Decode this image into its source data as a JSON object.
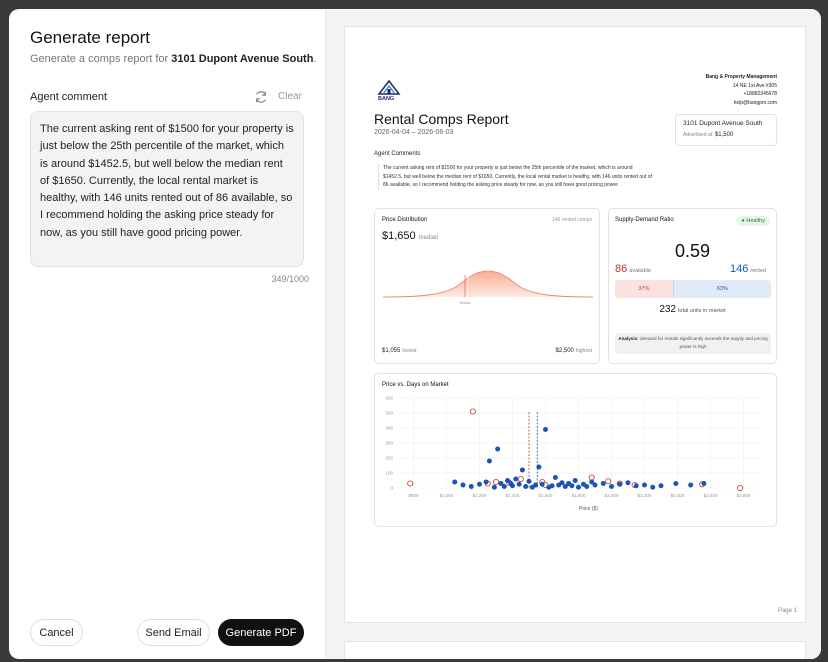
{
  "left": {
    "title": "Generate report",
    "subtitle_prefix": "Generate a comps report for ",
    "subtitle_address": "3101 Dupont Avenue South",
    "subtitle_suffix": ".",
    "comment_label": "Agent comment",
    "clear_label": "Clear",
    "comment_text": "The current asking rent of $1500 for your property is just below the 25th percentile of the market, which is around $1452.5, but well below the median rent of $1650. Currently, the local rental market is healthy, with 146 units rented out of 86 available, so I recommend holding the asking price steady for now, as you still have good pricing power.",
    "counter": "349/1000",
    "cancel_label": "Cancel",
    "send_email_label": "Send Email",
    "generate_pdf_label": "Generate PDF"
  },
  "report": {
    "logo_text": "BANG",
    "company_name": "Bang & Property Management",
    "company_address": "14 NE 1st Ave #305",
    "company_phone": "+18882345678",
    "company_email": "help@bangpm.com",
    "title": "Rental Comps Report",
    "dates": "2026-04-04 – 2026-06-03",
    "address": "3101 Dupont Avenue South",
    "advertised_label": "Advertised at:",
    "advertised_price": "$1,500",
    "agent_comments_label": "Agent Comments",
    "agent_comments_text": "The current asking rent of $1500 for your property is just below the 25th percentile of the market, which is around $1452.5, but well below the median rent of $1650. Currently, the local rental market is healthy, with 146 units rented out of 86 available, so I recommend holding the asking price steady for now, as you still have good pricing power.",
    "price_distribution": {
      "title": "Price Distribution",
      "rented_comps": "146 rented comps",
      "median_value": "$1,650",
      "median_label": "median",
      "lowest_value": "$1,055",
      "lowest_label": "lowest",
      "highest_value": "$2,500",
      "highest_label": "highest",
      "marker_label": "Median"
    },
    "supply_demand": {
      "title": "Supply-Demand Ratio",
      "status": "Healthy",
      "ratio": "0.59",
      "available_count": "86",
      "available_label": "available",
      "rented_count": "146",
      "rented_label": "rented",
      "available_pct": "37%",
      "rented_pct": "63%",
      "total_count": "232",
      "total_label": "total units in market",
      "analysis_label": "Analysis:",
      "analysis_text": "demand for rentals significantly exceeds the supply and pricing power is high"
    },
    "page_number": "Page 1"
  },
  "chart_data": {
    "type": "scatter",
    "title": "Price vs. Days on Market",
    "xlabel": "Price ($)",
    "ylabel": "",
    "xlim": [
      700,
      2900
    ],
    "ylim": [
      0,
      600
    ],
    "x_ticks": [
      "$800",
      "$1,000",
      "$1,200",
      "$1,400",
      "$1,600",
      "$1,800",
      "$2,000",
      "$2,200",
      "$2,400",
      "$2,600",
      "$2,800"
    ],
    "y_ticks": [
      "0",
      "100",
      "200",
      "300",
      "400",
      "500",
      "600"
    ],
    "reference_lines": [
      {
        "name": "advertised",
        "x": 1500,
        "color": "#c0392b"
      },
      {
        "name": "median",
        "x": 1550,
        "color": "#1a55b5"
      }
    ],
    "series": [
      {
        "name": "available",
        "color": "#c0392b",
        "points": [
          [
            780,
            30
          ],
          [
            1160,
            510
          ],
          [
            1250,
            30
          ],
          [
            1300,
            40
          ],
          [
            1380,
            35
          ],
          [
            1450,
            60
          ],
          [
            1580,
            40
          ],
          [
            1600,
            20
          ],
          [
            1880,
            70
          ],
          [
            1980,
            45
          ],
          [
            2050,
            30
          ],
          [
            2140,
            20
          ],
          [
            2550,
            25
          ],
          [
            2780,
            0
          ]
        ]
      },
      {
        "name": "rented",
        "color": "#1a55b5",
        "points": [
          [
            1050,
            40
          ],
          [
            1100,
            20
          ],
          [
            1150,
            10
          ],
          [
            1200,
            25
          ],
          [
            1240,
            40
          ],
          [
            1260,
            180
          ],
          [
            1290,
            5
          ],
          [
            1310,
            260
          ],
          [
            1330,
            30
          ],
          [
            1350,
            10
          ],
          [
            1370,
            50
          ],
          [
            1390,
            30
          ],
          [
            1400,
            15
          ],
          [
            1420,
            60
          ],
          [
            1440,
            25
          ],
          [
            1460,
            120
          ],
          [
            1480,
            10
          ],
          [
            1500,
            45
          ],
          [
            1520,
            5
          ],
          [
            1540,
            20
          ],
          [
            1560,
            140
          ],
          [
            1580,
            25
          ],
          [
            1600,
            390
          ],
          [
            1620,
            5
          ],
          [
            1640,
            15
          ],
          [
            1660,
            70
          ],
          [
            1680,
            20
          ],
          [
            1700,
            35
          ],
          [
            1720,
            10
          ],
          [
            1740,
            30
          ],
          [
            1760,
            15
          ],
          [
            1780,
            50
          ],
          [
            1800,
            5
          ],
          [
            1830,
            25
          ],
          [
            1850,
            10
          ],
          [
            1880,
            40
          ],
          [
            1900,
            20
          ],
          [
            1950,
            30
          ],
          [
            2000,
            10
          ],
          [
            2050,
            25
          ],
          [
            2100,
            35
          ],
          [
            2150,
            15
          ],
          [
            2200,
            20
          ],
          [
            2250,
            5
          ],
          [
            2300,
            15
          ],
          [
            2390,
            30
          ],
          [
            2480,
            20
          ],
          [
            2560,
            30
          ]
        ]
      }
    ]
  }
}
